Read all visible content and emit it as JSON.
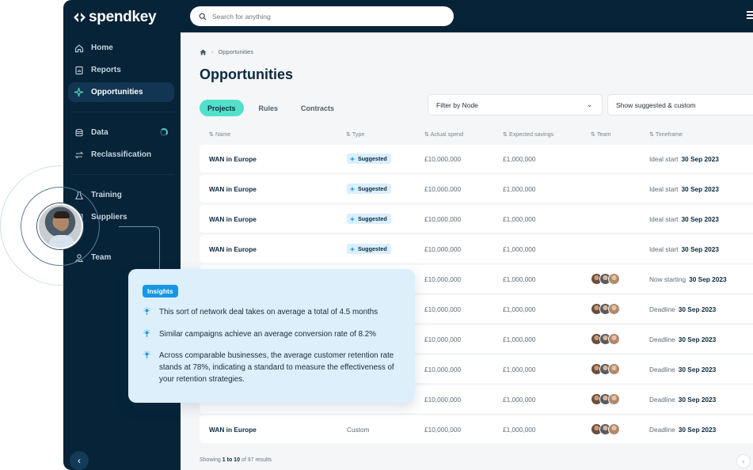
{
  "brand": {
    "name": "spendkey"
  },
  "sidebar": {
    "items": [
      {
        "label": "Home",
        "icon": "home-icon"
      },
      {
        "label": "Reports",
        "icon": "reports-icon"
      },
      {
        "label": "Opportunities",
        "icon": "sparkle-icon",
        "active": true
      },
      {
        "label": "Data",
        "icon": "database-icon"
      },
      {
        "label": "Reclassification",
        "icon": "swap-icon"
      },
      {
        "label": "Training",
        "icon": "flask-icon"
      },
      {
        "label": "Suppliers",
        "icon": "building-icon"
      },
      {
        "label": "Team",
        "icon": "team-icon"
      }
    ]
  },
  "search": {
    "placeholder": "Search for anything"
  },
  "breadcrumb": {
    "current": "Opportunities"
  },
  "page": {
    "title": "Opportunities"
  },
  "tabs": [
    {
      "label": "Projects",
      "active": true
    },
    {
      "label": "Rules"
    },
    {
      "label": "Contracts"
    }
  ],
  "filters": {
    "node": "Filter by Node",
    "mode": "Show suggested & custom"
  },
  "table": {
    "headers": {
      "name": "Name",
      "type": "Type",
      "actual": "Actual spend",
      "expected": "Expected savings",
      "team": "Team",
      "timeframe": "Timeframe"
    },
    "rows": [
      {
        "name": "WAN in Europe",
        "type": "Suggested",
        "actual": "£10,000,000",
        "expected": "£1,000,000",
        "tl_label": "Ideal start",
        "tl_date": "30 Sep 2023"
      },
      {
        "name": "WAN in Europe",
        "type": "Suggested",
        "actual": "£10,000,000",
        "expected": "£1,000,000",
        "tl_label": "Ideal start",
        "tl_date": "30 Sep 2023"
      },
      {
        "name": "WAN in Europe",
        "type": "Suggested",
        "actual": "£10,000,000",
        "expected": "£1,000,000",
        "tl_label": "Ideal start",
        "tl_date": "30 Sep 2023"
      },
      {
        "name": "WAN in Europe",
        "type": "Suggested",
        "actual": "£10,000,000",
        "expected": "£1,000,000",
        "tl_label": "Ideal start",
        "tl_date": "30 Sep 2023"
      },
      {
        "name": "",
        "type": "",
        "actual": "£10,000,000",
        "expected": "£1,000,000",
        "tl_label": "Now starting",
        "tl_date": "30 Sep 2023",
        "team": true
      },
      {
        "name": "",
        "type": "",
        "actual": "£10,000,000",
        "expected": "£1,000,000",
        "tl_label": "Deadline",
        "tl_date": "30 Sep 2023",
        "team": true
      },
      {
        "name": "",
        "type": "",
        "actual": "£10,000,000",
        "expected": "£1,000,000",
        "tl_label": "Deadline",
        "tl_date": "30 Sep 2023",
        "team": true
      },
      {
        "name": "",
        "type": "",
        "actual": "£10,000,000",
        "expected": "£1,000,000",
        "tl_label": "Deadline",
        "tl_date": "30 Sep 2023",
        "team": true
      },
      {
        "name": "",
        "type": "",
        "actual": "£10,000,000",
        "expected": "£1,000,000",
        "tl_label": "Deadline",
        "tl_date": "30 Sep 2023",
        "team": true
      },
      {
        "name": "WAN in Europe",
        "type": "Custom",
        "actual": "£10,000,000",
        "expected": "£1,000,000",
        "tl_label": "Deadline",
        "tl_date": "30 Sep 2023",
        "team": true
      }
    ]
  },
  "pagination": {
    "prefix": "Showing ",
    "range": "1 to 10",
    "suffix": " of 97 results"
  },
  "insights": {
    "badge": "Insights",
    "items": [
      "This sort of network deal takes on average a total of 4.5 months",
      "Similar campaigns achieve an average conversion rate of 8.2%",
      "Across comparable businesses, the average customer retention rate stands at 78%, indicating a standard to measure the effectiveness of your retention strategies."
    ]
  },
  "colors": {
    "sidebar": "#062338",
    "accent": "#52e0c8",
    "insight_blue": "#1597e5"
  }
}
